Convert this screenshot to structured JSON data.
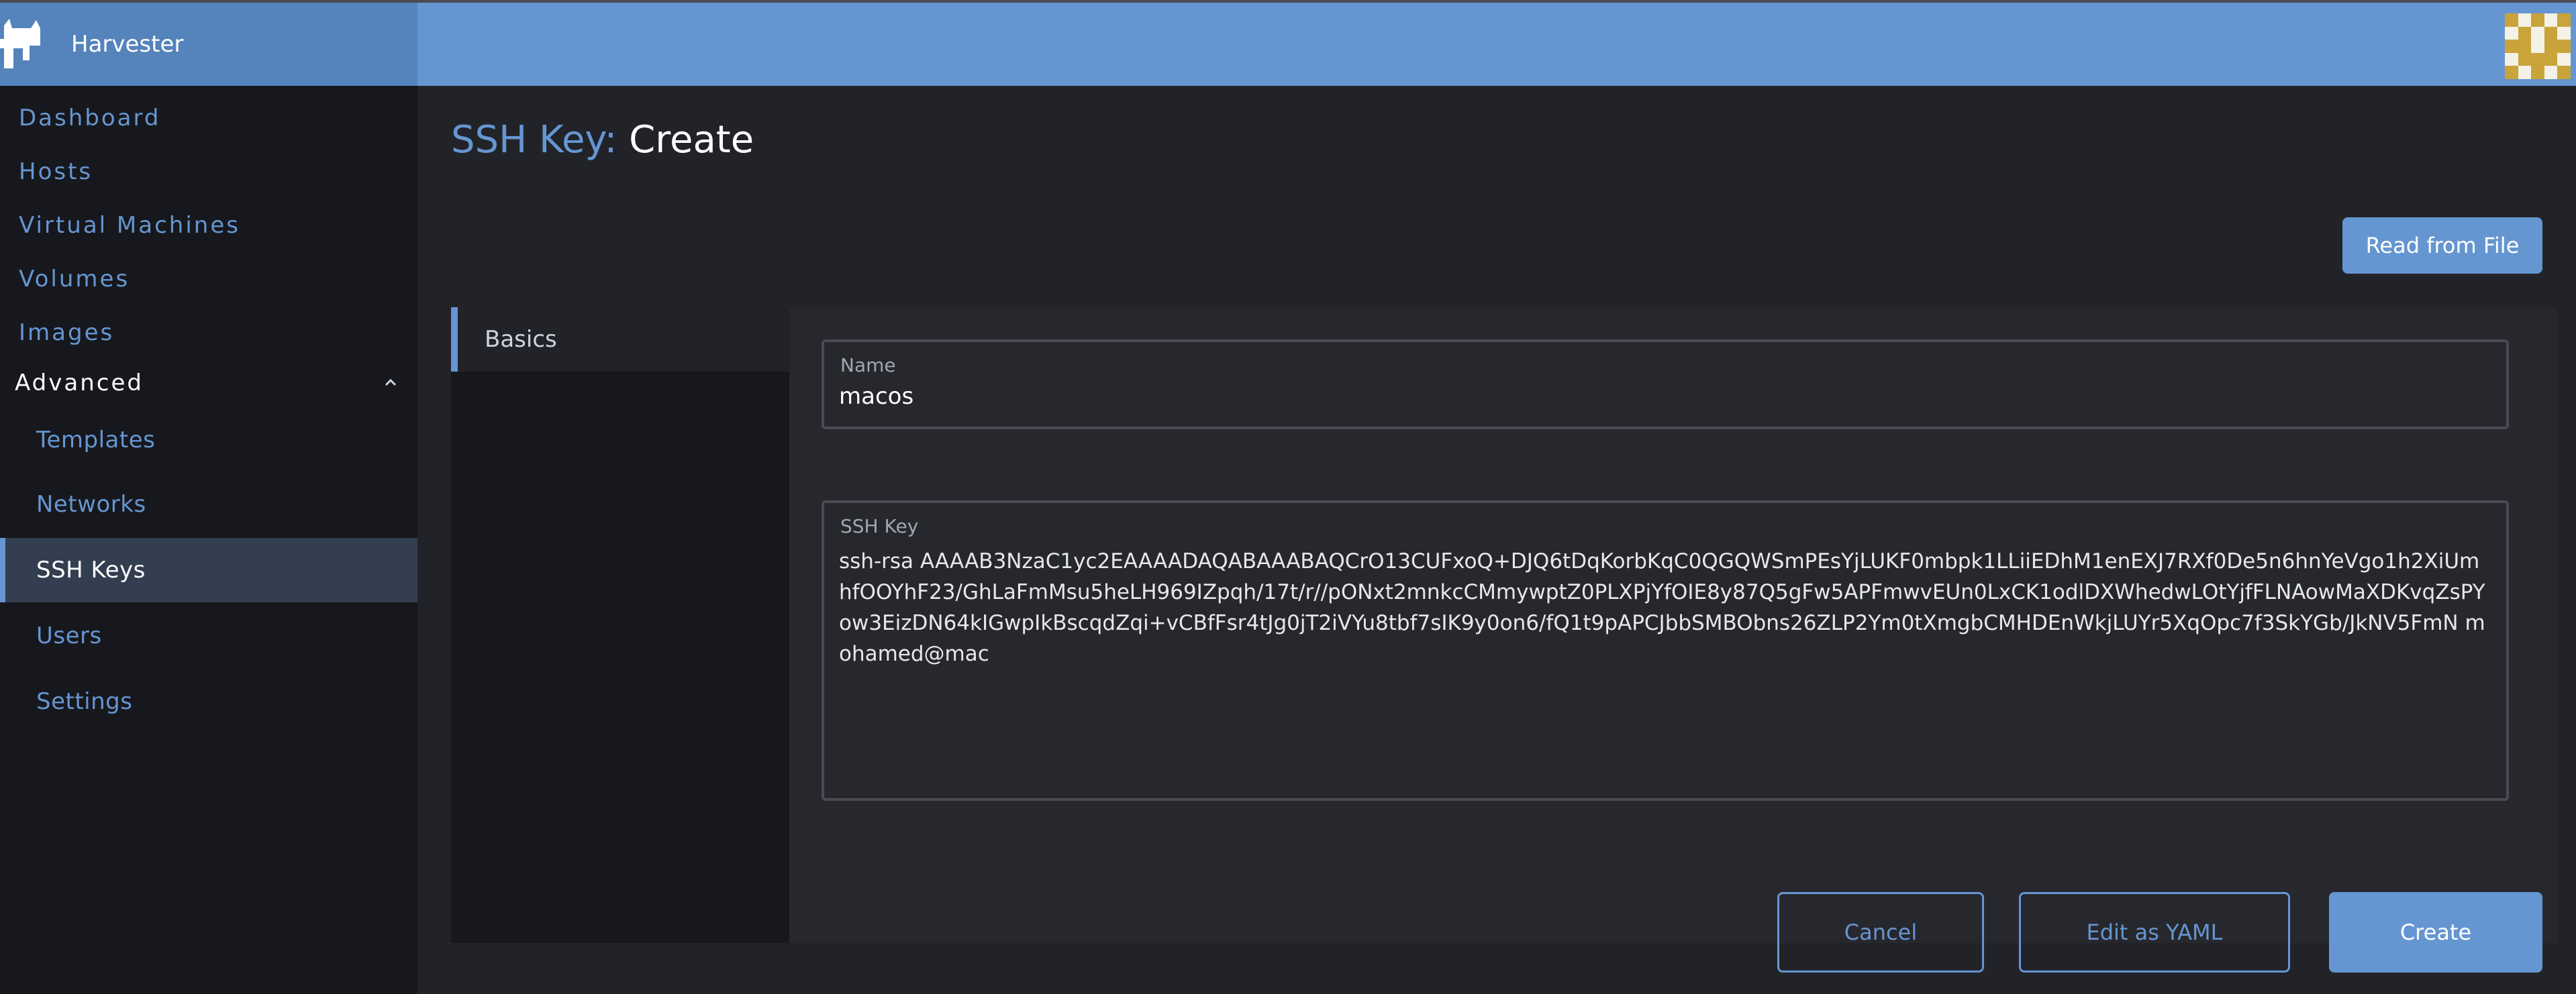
{
  "app": {
    "brand_name": "Harvester"
  },
  "sidebar": {
    "items": [
      {
        "label": "Dashboard"
      },
      {
        "label": "Hosts"
      },
      {
        "label": "Virtual Machines"
      },
      {
        "label": "Volumes"
      },
      {
        "label": "Images"
      }
    ],
    "group": {
      "label": "Advanced",
      "expanded": true,
      "items": [
        {
          "label": "Templates"
        },
        {
          "label": "Networks"
        },
        {
          "label": "SSH Keys",
          "active": true
        },
        {
          "label": "Users"
        },
        {
          "label": "Settings"
        }
      ]
    }
  },
  "page": {
    "resource": "SSH Key:",
    "mode": "Create",
    "read_from_file_label": "Read from File"
  },
  "tabs": [
    {
      "label": "Basics",
      "active": true
    }
  ],
  "form": {
    "name_label": "Name",
    "name_value": "macos",
    "ssh_key_label": "SSH Key",
    "ssh_key_value": "ssh-rsa AAAAB3NzaC1yc2EAAAADAQABAAABAQCrO13CUFxoQ+DJQ6tDqKorbKqC0QGQWSmPEsYjLUKF0mbpk1LLiiEDhM1enEXJ7RXf0De5n6hnYeVgo1h2XiUmhfOOYhF23/GhLaFmMsu5heLH969IZpqh/17t/r//pONxt2mnkcCMmywptZ0PLXPjYfOIE8y87Q5gFw5APFmwvEUn0LxCK1odlDXWhedwLOtYjfFLNAowMaXDKvqZsPYow3EizDN64kIGwpIkBscqdZqi+vCBfFsr4tJg0jT2iVYu8tbf7sIK9y0on6/fQ1t9pAPCJbbSMBObns26ZLP2Ym0tXmgbCMHDEnWkjLUYr5XqOpc7f3SkYGb/JkNV5FmN mohamed@mac"
  },
  "footer": {
    "cancel_label": "Cancel",
    "edit_yaml_label": "Edit as YAML",
    "create_label": "Create"
  },
  "colors": {
    "accent": "#6596d1",
    "header": "#6596d1",
    "sidebar_bg": "#17181d",
    "main_bg": "#222329",
    "active_nav_bg": "#333e50"
  }
}
